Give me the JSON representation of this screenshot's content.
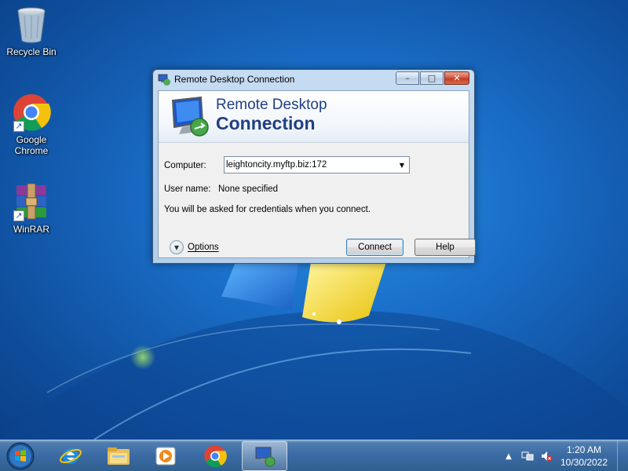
{
  "desktop": {
    "icons": [
      {
        "label": "Recycle Bin",
        "icon": "recycle-bin-icon"
      },
      {
        "label": "Google\nChrome",
        "icon": "chrome-icon"
      },
      {
        "label": "WinRAR",
        "icon": "winrar-icon"
      }
    ]
  },
  "window": {
    "title": "Remote Desktop Connection",
    "banner_line1": "Remote Desktop",
    "banner_line2": "Connection",
    "computer_label": "Computer:",
    "computer_value": "leightoncity.myftp.biz:172",
    "username_label": "User name:",
    "username_value": "None specified",
    "credentials_note": "You will be asked for credentials when you connect.",
    "options_label": "Options",
    "connect_label": "Connect",
    "help_label": "Help",
    "caption_minimize": "–",
    "caption_maximize": "□",
    "caption_close": "✕",
    "combo_arrow": "▼",
    "options_arrow": "▼"
  },
  "taskbar": {
    "items": [
      "start-orb",
      "internet-explorer-icon",
      "file-explorer-icon",
      "media-player-icon",
      "chrome-icon",
      "remote-desktop-icon"
    ],
    "active_item": "remote-desktop-icon",
    "tray_arrow": "▲",
    "clock_time": "1:20 AM",
    "clock_date": "10/30/2022"
  },
  "colors": {
    "desktop": "#1a6fc9",
    "banner_text": "#1f3f83",
    "close_button": "#c33a1f",
    "taskbar": "#3a6aa3"
  }
}
